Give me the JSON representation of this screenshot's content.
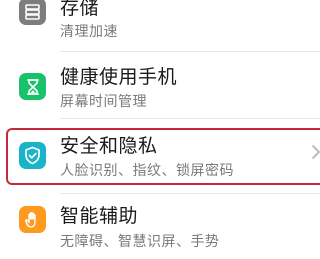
{
  "settings": {
    "items": [
      {
        "title": "存储",
        "subtitle": "清理加速",
        "icon": "storage-icon",
        "icon_color": "#7d7d7d"
      },
      {
        "title": "健康使用手机",
        "subtitle": "屏幕时间管理",
        "icon": "hourglass-icon",
        "icon_color": "#17c26b"
      },
      {
        "title": "安全和隐私",
        "subtitle": "人脸识别、指纹、锁屏密码",
        "icon": "shield-icon",
        "icon_color": "#1ab4c9"
      },
      {
        "title": "智能辅助",
        "subtitle": "无障碍、智慧识屏、手势",
        "icon": "hand-icon",
        "icon_color": "#ff9a1f"
      }
    ],
    "highlight_color": "#c8283c"
  }
}
